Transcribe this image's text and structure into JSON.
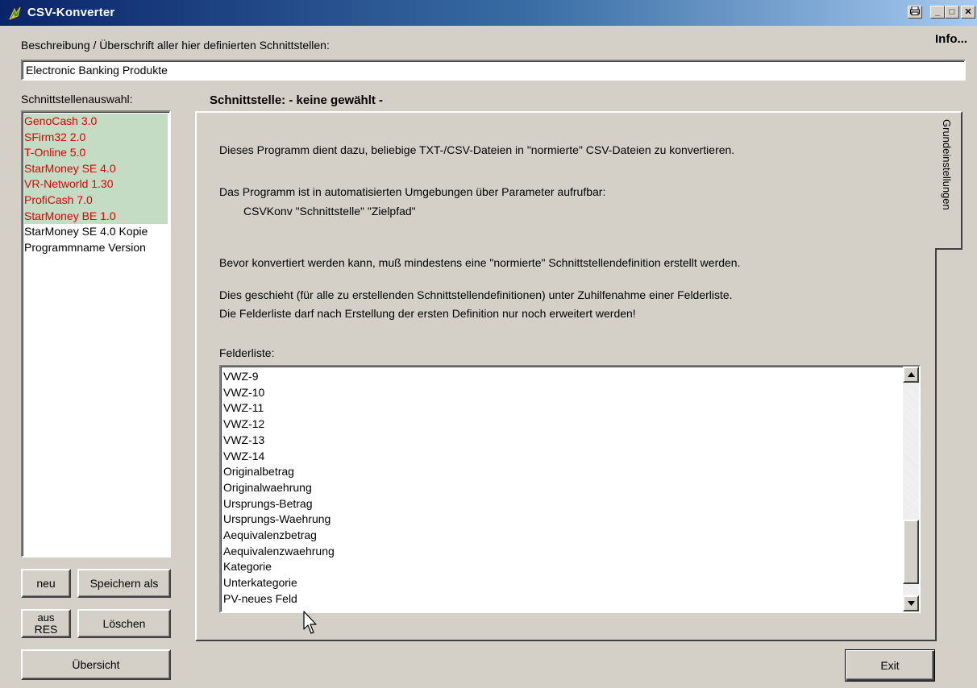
{
  "window": {
    "title": "CSV-Konverter",
    "info_label": "Info...",
    "title_buttons": {
      "print": "🖶",
      "minimize": "_",
      "maximize": "□",
      "close": "✕"
    }
  },
  "description": {
    "label": "Beschreibung / Überschrift aller hier definierten Schnittstellen:",
    "value": "Electronic Banking Produkte"
  },
  "interfaces": {
    "label": "Schnittstellenauswahl:",
    "items": [
      {
        "label": "GenoCash 3.0",
        "highlight": true
      },
      {
        "label": "SFirm32 2.0",
        "highlight": true
      },
      {
        "label": "T-Online 5.0",
        "highlight": true
      },
      {
        "label": "StarMoney SE 4.0",
        "highlight": true
      },
      {
        "label": "VR-Networld 1.30",
        "highlight": true
      },
      {
        "label": "ProfiCash 7.0",
        "highlight": true
      },
      {
        "label": "StarMoney BE 1.0",
        "highlight": true
      },
      {
        "label": "StarMoney SE 4.0 Kopie",
        "highlight": false
      },
      {
        "label": "Programmname Version",
        "highlight": false
      }
    ]
  },
  "buttons": {
    "new": "neu",
    "save_as": "Speichern als",
    "from_res_line1": "aus",
    "from_res_line2": "RES",
    "delete": "Löschen",
    "overview": "Übersicht",
    "exit": "Exit"
  },
  "main": {
    "header": "Schnittstelle: - keine gewählt -",
    "tab": "Grundeinstellungen",
    "text1": "Dieses Programm dient dazu, beliebige TXT-/CSV-Dateien in \"normierte\" CSV-Dateien zu konvertieren.",
    "text2": "Das Programm ist in automatisierten Umgebungen über Parameter aufrufbar:",
    "text3": "CSVKonv \"Schnittstelle\" \"Zielpfad\"",
    "text4": "Bevor konvertiert werden kann, muß mindestens eine \"normierte\" Schnittstellendefinition erstellt werden.",
    "text5": "Dies geschieht (für alle zu erstellenden Schnittstellendefinitionen) unter Zuhilfenahme einer Felderliste.",
    "text6": "Die Felderliste darf nach Erstellung der ersten Definition nur noch erweitert werden!",
    "fields_label": "Felderliste:",
    "fields": [
      "VWZ-9",
      "VWZ-10",
      "VWZ-11",
      "VWZ-12",
      "VWZ-13",
      "VWZ-14",
      "Originalbetrag",
      "Originalwaehrung",
      "Ursprungs-Betrag",
      "Ursprungs-Waehrung",
      "Aequivalenzbetrag",
      "Aequivalenzwaehrung",
      "Kategorie",
      "Unterkategorie",
      "PV-neues Feld"
    ]
  },
  "colors": {
    "highlight_bg": "#c4dcc4",
    "highlight_text": "#e00000",
    "title_start": "#0a246a",
    "title_end": "#a6caf0"
  },
  "icons": {
    "app": "app-leaf-icon",
    "scroll_up": "scroll-up-arrow-icon",
    "scroll_down": "scroll-down-arrow-icon",
    "cursor": "mouse-pointer-icon"
  }
}
